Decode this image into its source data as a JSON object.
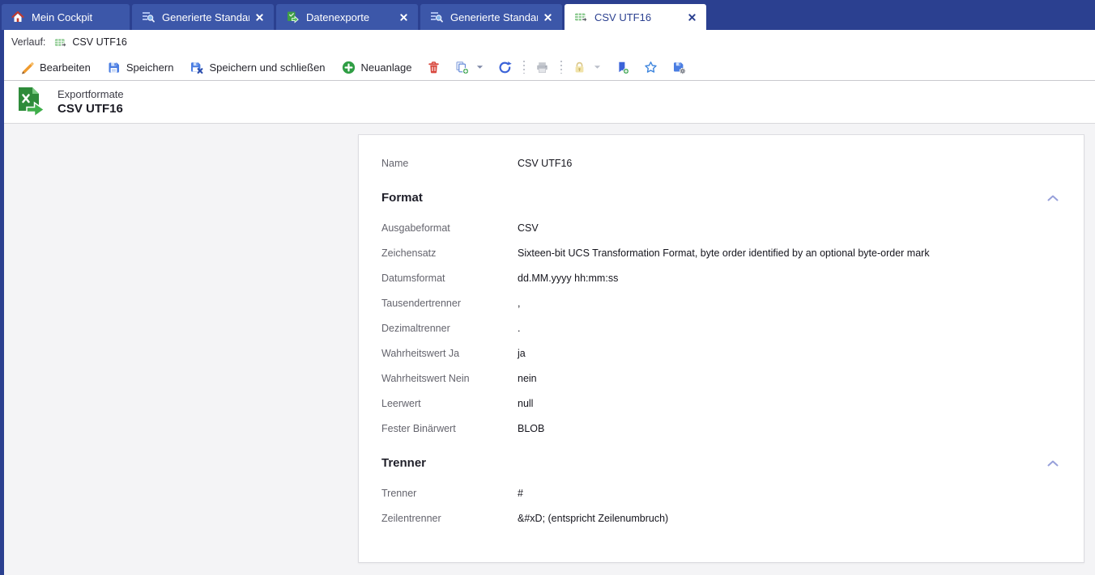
{
  "colors": {
    "tab_bar_bg": "#2b4090",
    "tab_inactive_bg": "#3c57a9",
    "tab_active_bg": "#ffffff",
    "accent_blue": "#3b63d8",
    "accent_green": "#2f9e44",
    "accent_red": "#d8463c",
    "accent_orange": "#ef9a2d",
    "content_bg": "#f4f4f6"
  },
  "tabs": {
    "items": [
      {
        "label": "Mein Cockpit",
        "icon": "home-icon",
        "active": false,
        "closable": false
      },
      {
        "label": "Generierte Standar...",
        "icon": "report-search-icon",
        "active": false,
        "closable": true
      },
      {
        "label": "Datenexporte",
        "icon": "export-icon",
        "active": false,
        "closable": true
      },
      {
        "label": "Generierte Standar...",
        "icon": "report-search-icon",
        "active": false,
        "closable": true
      },
      {
        "label": "CSV UTF16",
        "icon": "csv-format-icon",
        "active": true,
        "closable": true
      }
    ]
  },
  "history": {
    "label": "Verlauf:",
    "item_label": "CSV UTF16",
    "item_icon": "csv-format-icon"
  },
  "toolbar": {
    "edit_label": "Bearbeiten",
    "save_label": "Speichern",
    "save_close_label": "Speichern und schließen",
    "new_label": "Neuanlage",
    "icon_buttons": [
      "delete-icon",
      "copy-add-icon",
      "refresh-icon",
      "print-icon",
      "lock-icon",
      "bookmark-add-icon",
      "star-icon",
      "save-settings-icon"
    ]
  },
  "header": {
    "type_label": "Exportformate",
    "title": "CSV UTF16",
    "icon": "export-format-icon"
  },
  "form": {
    "name_field": {
      "label": "Name",
      "value": "CSV UTF16"
    },
    "sections": [
      {
        "title": "Format",
        "collapse_icon": "chevron-up-icon",
        "fields": [
          {
            "label": "Ausgabeformat",
            "value": "CSV"
          },
          {
            "label": "Zeichensatz",
            "value": "Sixteen-bit UCS Transformation Format, byte order identified by an optional byte-order mark"
          },
          {
            "label": "Datumsformat",
            "value": "dd.MM.yyyy hh:mm:ss"
          },
          {
            "label": "Tausendertrenner",
            "value": ","
          },
          {
            "label": "Dezimaltrenner",
            "value": "."
          },
          {
            "label": "Wahrheitswert Ja",
            "value": "ja"
          },
          {
            "label": "Wahrheitswert Nein",
            "value": "nein"
          },
          {
            "label": "Leerwert",
            "value": "null"
          },
          {
            "label": "Fester Binärwert",
            "value": "BLOB"
          }
        ]
      },
      {
        "title": "Trenner",
        "collapse_icon": "chevron-up-icon",
        "fields": [
          {
            "label": "Trenner",
            "value": "#"
          },
          {
            "label": "Zeilentrenner",
            "value": "&#xD; (entspricht Zeilenumbruch)"
          }
        ]
      }
    ]
  }
}
